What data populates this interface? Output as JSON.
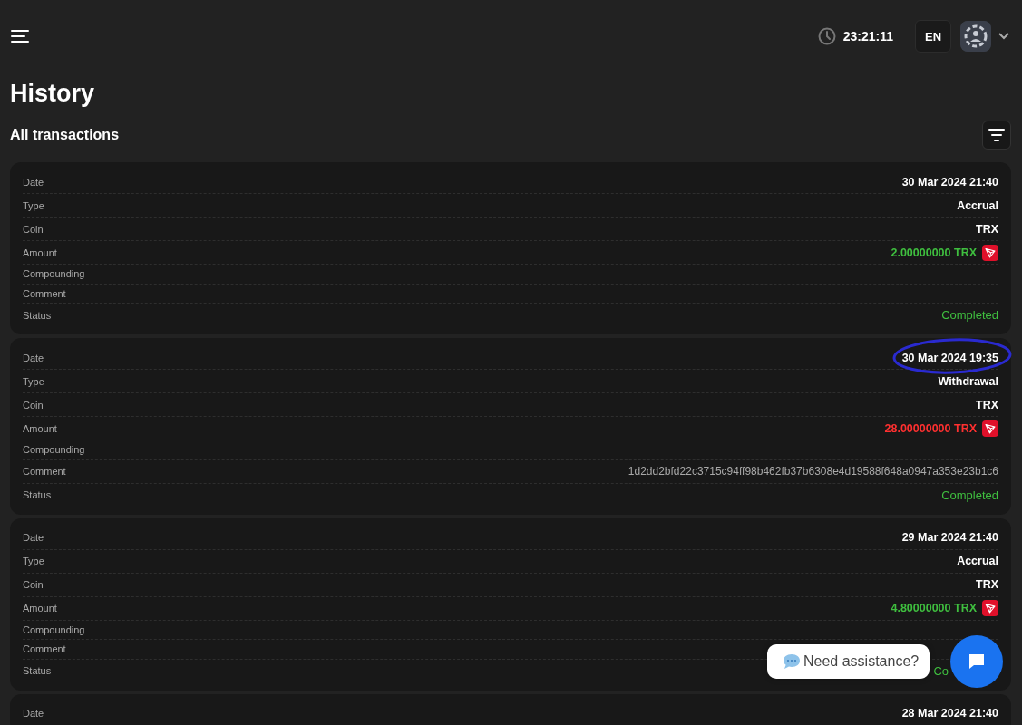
{
  "header": {
    "time": "23:21:11",
    "language": "EN"
  },
  "title": "History",
  "section_title": "All transactions",
  "transactions": [
    {
      "circled": false,
      "rows": [
        {
          "kind": "date",
          "label": "Date",
          "value": "30 Mar 2024 21:40"
        },
        {
          "kind": "text",
          "label": "Type",
          "value": "Accrual"
        },
        {
          "kind": "text",
          "label": "Coin",
          "value": "TRX"
        },
        {
          "kind": "amount",
          "label": "Amount",
          "value": "2.00000000 TRX",
          "color": "#3fbf3f"
        },
        {
          "kind": "text",
          "label": "Compounding"
        },
        {
          "kind": "comment",
          "label": "Comment"
        },
        {
          "kind": "status",
          "label": "Status",
          "value": "Completed"
        }
      ]
    },
    {
      "circled": true,
      "rows": [
        {
          "kind": "date",
          "label": "Date",
          "value": "30 Mar 2024 19:35"
        },
        {
          "kind": "text",
          "label": "Type",
          "value": "Withdrawal"
        },
        {
          "kind": "text",
          "label": "Coin",
          "value": "TRX"
        },
        {
          "kind": "amount",
          "label": "Amount",
          "value": "28.00000000 TRX",
          "color": "#ff3030"
        },
        {
          "kind": "text",
          "label": "Compounding"
        },
        {
          "kind": "comment",
          "label": "Comment",
          "value": "1d2dd2bfd22c3715c94ff98b462fb37b6308e4d19588f648a0947a353e23b1c6"
        },
        {
          "kind": "status",
          "label": "Status",
          "value": "Completed"
        }
      ]
    },
    {
      "circled": false,
      "rows": [
        {
          "kind": "date",
          "label": "Date",
          "value": "29 Mar 2024 21:40"
        },
        {
          "kind": "text",
          "label": "Type",
          "value": "Accrual"
        },
        {
          "kind": "text",
          "label": "Coin",
          "value": "TRX"
        },
        {
          "kind": "amount",
          "label": "Amount",
          "value": "4.80000000 TRX",
          "color": "#3fbf3f"
        },
        {
          "kind": "text",
          "label": "Compounding"
        },
        {
          "kind": "comment",
          "label": "Comment"
        },
        {
          "kind": "status",
          "label": "Status",
          "value": "Co",
          "covered": true
        }
      ]
    },
    {
      "circled": false,
      "rows": [
        {
          "kind": "date",
          "label": "Date",
          "value": "28 Mar 2024 21:40"
        }
      ]
    }
  ],
  "chat": {
    "prompt": "Need assistance?"
  }
}
